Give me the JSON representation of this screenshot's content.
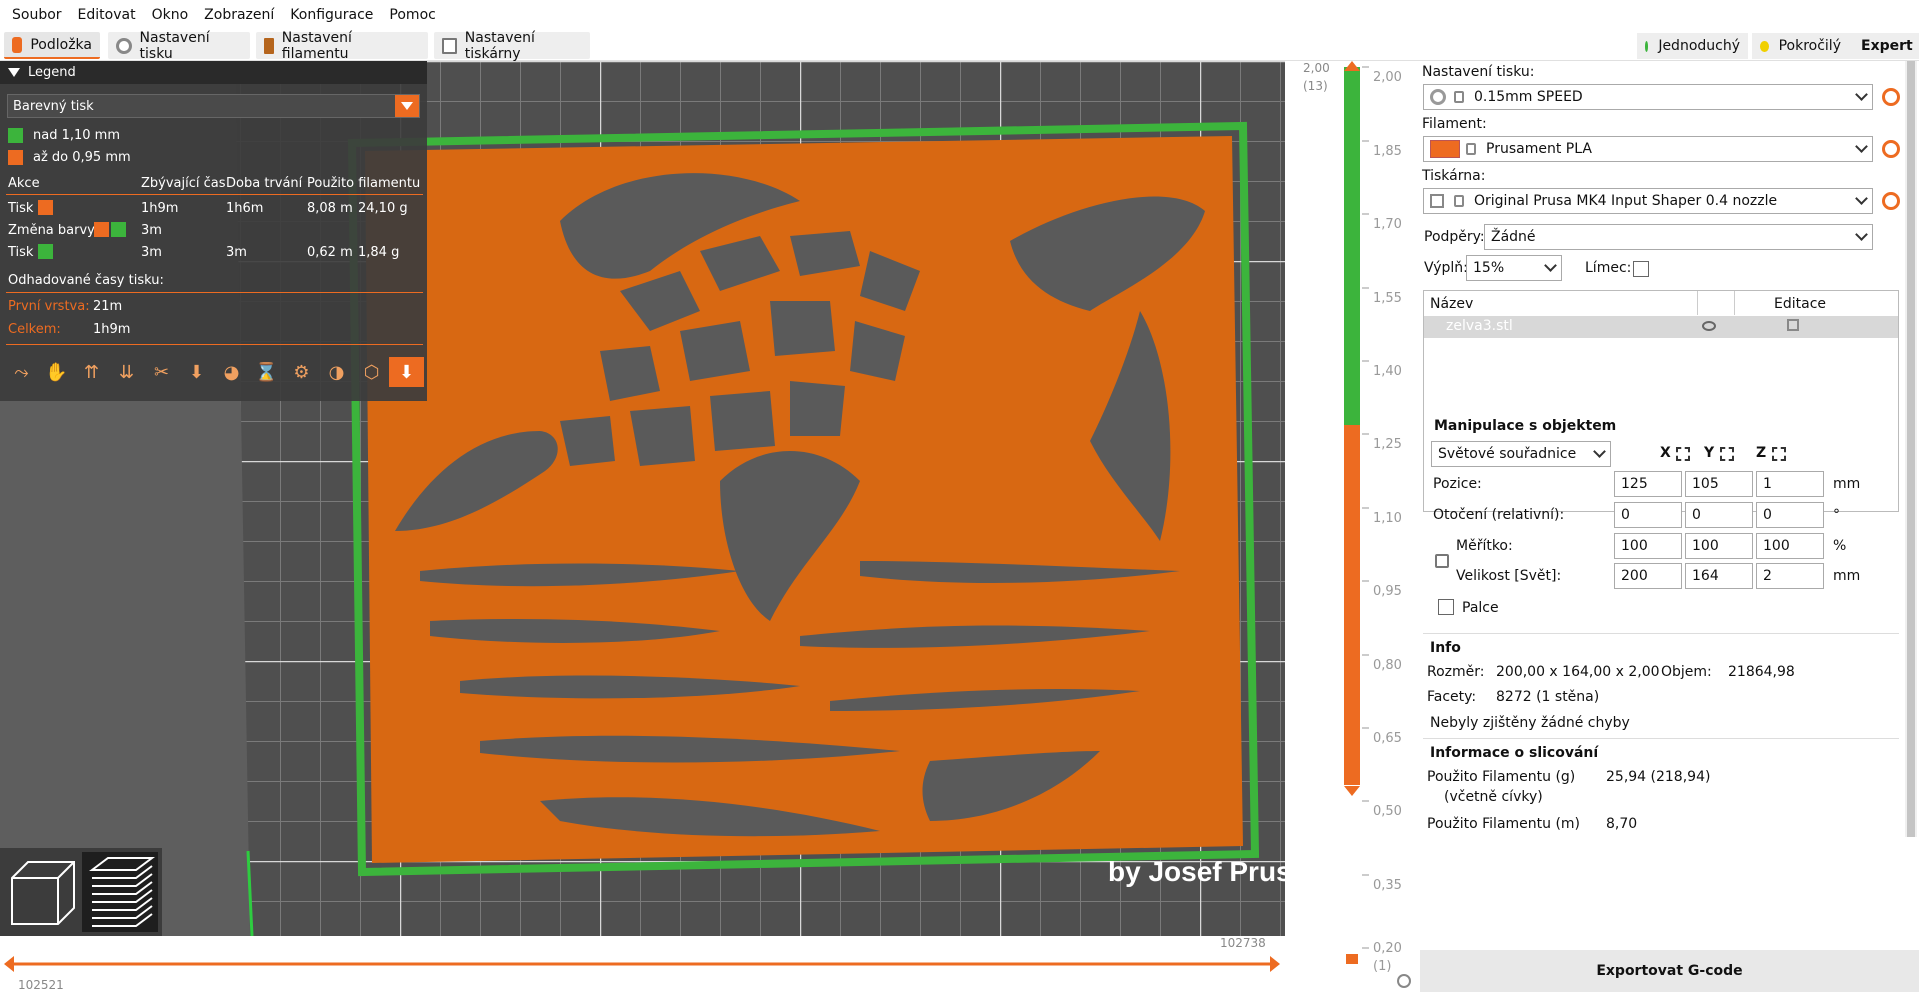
{
  "menu": [
    "Soubor",
    "Editovat",
    "Okno",
    "Zobrazení",
    "Konfigurace",
    "Pomoc"
  ],
  "tabs": [
    {
      "label": "Podložka",
      "color": "#ed6b21"
    },
    {
      "label": "Nastavení tisku",
      "color": "#888888"
    },
    {
      "label": "Nastavení filamentu",
      "color": "#b5651d"
    },
    {
      "label": "Nastavení tiskárny",
      "color": "#888888"
    }
  ],
  "modes": [
    {
      "label": "Jednoduchý",
      "color": "#3cb43c"
    },
    {
      "label": "Pokročilý",
      "color": "#f0d000"
    },
    {
      "label": "Expert",
      "color": "#e00000"
    }
  ],
  "legend": {
    "title": "Legend",
    "view_type": "Barevný tisk",
    "ranges": [
      {
        "label": "nad 1,10 mm",
        "color": "#3cb43c"
      },
      {
        "label": "až do 0,95 mm",
        "color": "#ed6b21"
      }
    ],
    "columns": [
      "Akce",
      "Zbývající čas",
      "Doba trvání",
      "Použito filamentu"
    ],
    "rows": [
      {
        "action": "Tisk",
        "remaining": "1h9m",
        "duration": "1h6m",
        "length": "8,08 m",
        "weight": "24,10 g"
      },
      {
        "action": "Změna barvy",
        "remaining": "3m",
        "duration": "",
        "length": "",
        "weight": ""
      },
      {
        "action": "Tisk",
        "remaining": "3m",
        "duration": "3m",
        "length": "0,62 m",
        "weight": "1,84 g"
      }
    ],
    "estimated_title": "Odhadované časy tisku:",
    "first_layer_label": "První vrstva:",
    "first_layer_value": "21m",
    "total_label": "Celkem:",
    "total_value": "1h9m"
  },
  "scene": {
    "watermark": "by Josef Prus"
  },
  "hslider": {
    "right_value": "102738",
    "left_value": "102521"
  },
  "vslider": {
    "top_value": "2,00",
    "top_layer": "(13)",
    "ticks": [
      "2,00",
      "1,85",
      "1,70",
      "1,55",
      "1,40",
      "1,25",
      "1,10",
      "0,95",
      "0,80",
      "0,65",
      "0,50",
      "0,35",
      "0,20"
    ],
    "bottom_layer": "(1)"
  },
  "panel": {
    "print_settings_label": "Nastavení tisku:",
    "print_settings_value": "0.15mm SPEED",
    "filament_label": "Filament:",
    "filament_value": "Prusament PLA",
    "filament_color": "#ed6b21",
    "printer_label": "Tiskárna:",
    "printer_value": "Original Prusa MK4 Input Shaper 0.4 nozzle",
    "supports_label": "Podpěry:",
    "supports_value": "Žádné",
    "infill_label": "Výplň:",
    "infill_value": "15%",
    "brim_label": "Límec:",
    "list_col_name": "Název",
    "list_col_edit": "Editace",
    "object_name": "zelva3.stl",
    "manip_title": "Manipulace s objektem",
    "coord_value": "Světové souřadnice",
    "axes": [
      "X",
      "Y",
      "Z"
    ],
    "position_label": "Pozice:",
    "position": [
      "125",
      "105",
      "1"
    ],
    "position_unit": "mm",
    "rotation_label": "Otočení (relativní):",
    "rotation": [
      "0",
      "0",
      "0"
    ],
    "rotation_unit": "°",
    "scale_label": "Měřítko:",
    "scale": [
      "100",
      "100",
      "100"
    ],
    "scale_unit": "%",
    "size_label": "Velikost [Svět]:",
    "size": [
      "200",
      "164",
      "2"
    ],
    "size_unit": "mm",
    "inches_label": "Palce",
    "info_title": "Info",
    "size_info_label": "Rozměr:",
    "size_info_value": "200,00 x 164,00 x 2,00",
    "volume_label": "Objem:",
    "volume_value": "21864,98",
    "facets_label": "Facety:",
    "facets_value": "8272 (1 stěna)",
    "errors_text": "Nebyly zjištěny žádné chyby",
    "slice_title": "Informace o slicování",
    "fil_g_label": "Použito Filamentu (g)",
    "fil_g_sub": "(včetně cívky)",
    "fil_g_value": "25,94 (218,94)",
    "fil_m_label": "Použito Filamentu (m)",
    "fil_m_value": "8,70",
    "export_label": "Exportovat G-code"
  }
}
